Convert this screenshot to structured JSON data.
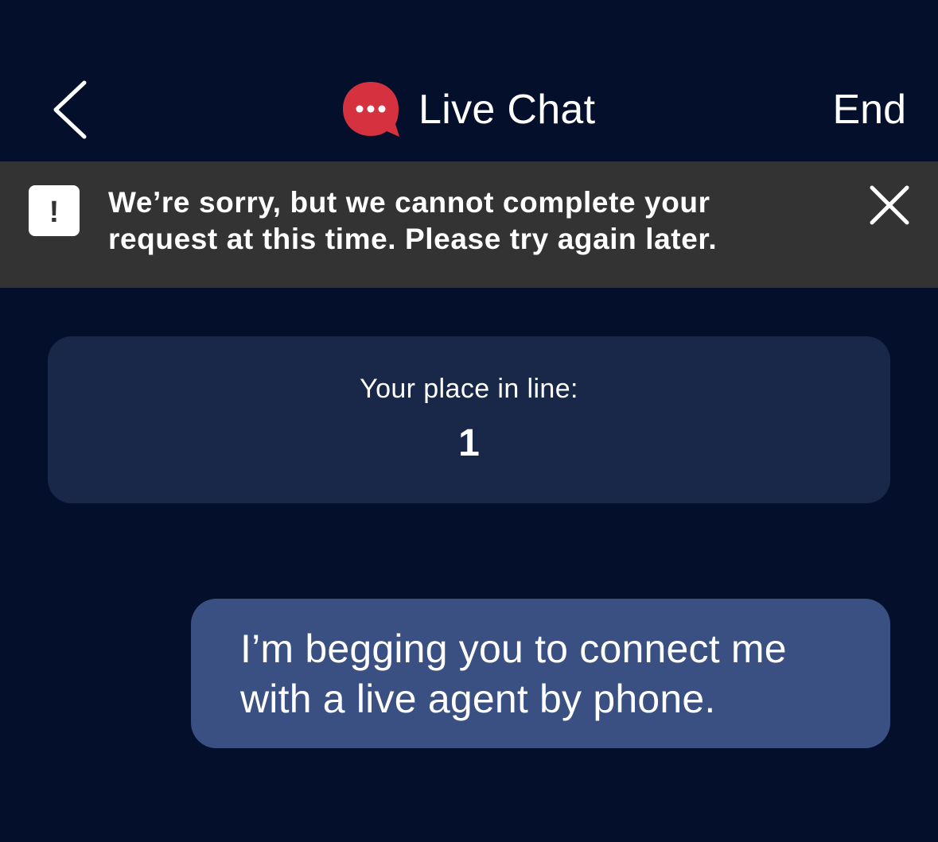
{
  "header": {
    "title": "Live Chat",
    "end_label": "End",
    "back_icon": "chevron-left-icon",
    "chat_icon": "chat-bubble-icon",
    "chat_icon_color": "#d6313f"
  },
  "banner": {
    "message": "We’re sorry, but we cannot complete your request at this time. Please try again later.",
    "alert_icon": "alert-icon",
    "alert_glyph": "!",
    "close_icon": "close-icon",
    "background": "#333333"
  },
  "queue": {
    "label": "Your place in line:",
    "value": "1"
  },
  "messages": [
    {
      "sender": "user",
      "text": "I’m begging you to connect me with a live agent by phone."
    }
  ],
  "colors": {
    "background": "#04102b",
    "card": "#192748",
    "user_bubble": "#3a5082"
  }
}
